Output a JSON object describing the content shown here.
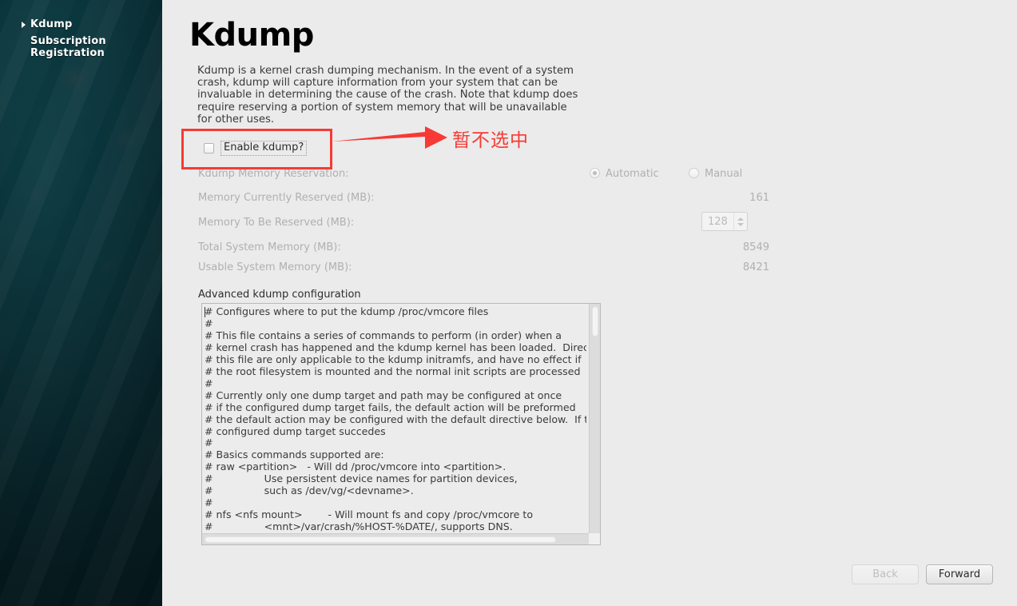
{
  "sidebar": {
    "items": [
      {
        "label": "Kdump",
        "selected": true
      },
      {
        "label": "Subscription Registration",
        "selected": false
      }
    ]
  },
  "main": {
    "title": "Kdump",
    "description": "Kdump is a kernel crash dumping mechanism. In the event of a system crash, kdump will capture information from your system that can be invaluable in determining the cause of the crash. Note that kdump does require reserving a portion of system memory that will be unavailable for other uses.",
    "enable_checkbox": {
      "label": "Enable kdump?",
      "checked": false,
      "focused": true
    },
    "memory_reservation": {
      "label": "Kdump Memory Reservation:",
      "options": [
        {
          "label": "Automatic",
          "selected": true
        },
        {
          "label": "Manual",
          "selected": false
        }
      ],
      "disabled": true
    },
    "rows": [
      {
        "label": "Memory Currently Reserved (MB):",
        "value": "161"
      },
      {
        "label": "Total System Memory (MB):",
        "value": "8549"
      },
      {
        "label": "Usable System Memory (MB):",
        "value": "8421"
      }
    ],
    "memory_to_be_reserved": {
      "label": "Memory To Be Reserved (MB):",
      "value": "128"
    },
    "advanced": {
      "label": "Advanced kdump configuration",
      "content": "# Configures where to put the kdump /proc/vmcore files\n#\n# This file contains a series of commands to perform (in order) when a\n# kernel crash has happened and the kdump kernel has been loaded.  Direc\n# this file are only applicable to the kdump initramfs, and have no effect if\n# the root filesystem is mounted and the normal init scripts are processed\n#\n# Currently only one dump target and path may be configured at once\n# if the configured dump target fails, the default action will be preformed\n# the default action may be configured with the default directive below.  If th\n# configured dump target succedes\n#\n# Basics commands supported are:\n# raw <partition>   - Will dd /proc/vmcore into <partition>.\n#                Use persistent device names for partition devices,\n#                such as /dev/vg/<devname>.\n#\n# nfs <nfs mount>        - Will mount fs and copy /proc/vmcore to\n#                <mnt>/var/crash/%HOST-%DATE/, supports DNS."
    }
  },
  "footer": {
    "back_label": "Back",
    "back_disabled": true,
    "forward_label": "Forward",
    "forward_disabled": false
  },
  "annotation": {
    "text": "暂不选中",
    "color": "#f73a35"
  }
}
